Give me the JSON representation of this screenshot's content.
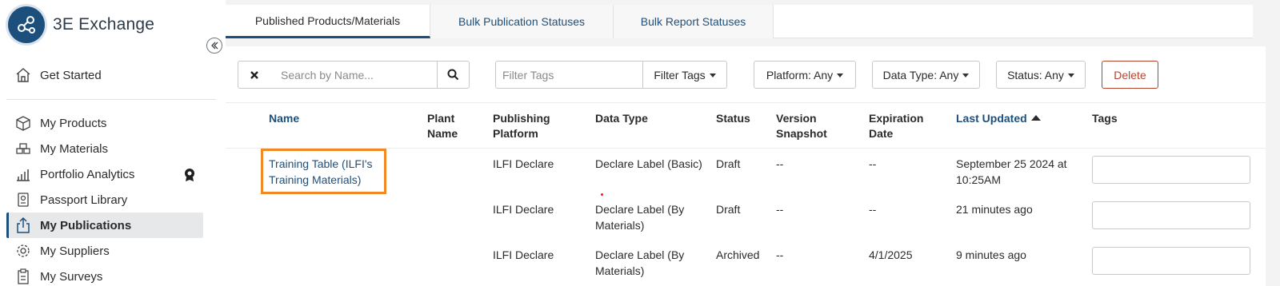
{
  "app": {
    "name": "3E Exchange"
  },
  "sidebar": {
    "items": [
      {
        "label": "Get Started",
        "icon": "home-icon"
      },
      {
        "label": "My Products",
        "icon": "box-icon"
      },
      {
        "label": "My Materials",
        "icon": "materials-icon"
      },
      {
        "label": "Portfolio Analytics",
        "icon": "bar-chart-icon"
      },
      {
        "label": "Passport Library",
        "icon": "passport-icon"
      },
      {
        "label": "My Publications",
        "icon": "upload-icon",
        "active": true
      },
      {
        "label": "My Suppliers",
        "icon": "suppliers-icon"
      },
      {
        "label": "My Surveys",
        "icon": "clipboard-icon"
      }
    ]
  },
  "tabs": [
    {
      "label": "Published Products/Materials",
      "active": true
    },
    {
      "label": "Bulk Publication Statuses"
    },
    {
      "label": "Bulk Report Statuses"
    }
  ],
  "toolbar": {
    "search_placeholder": "Search by Name...",
    "filter_tags_placeholder": "Filter Tags",
    "filter_tags_label": "Filter Tags",
    "platform_label": "Platform: Any",
    "data_type_label": "Data Type: Any",
    "status_label": "Status: Any",
    "delete_label": "Delete"
  },
  "table": {
    "columns": {
      "name": "Name",
      "plant_name": "Plant Name",
      "publishing_platform": "Publishing Platform",
      "data_type": "Data Type",
      "status": "Status",
      "version_snapshot": "Version Snapshot",
      "expiration_date": "Expiration Date",
      "last_updated": "Last Updated",
      "tags": "Tags"
    },
    "rows": [
      {
        "name": "Training Table (ILFI's Training Materials)",
        "plant_name": "",
        "platform": "ILFI Declare",
        "data_type": "Declare Label (Basic)",
        "status": "Draft",
        "version_snapshot": "--",
        "expiration_date": "--",
        "last_updated": "September 25 2024 at 10:25AM"
      },
      {
        "name": "",
        "plant_name": "",
        "platform": "ILFI Declare",
        "data_type": "Declare Label (By Materials)",
        "status": "Draft",
        "version_snapshot": "--",
        "expiration_date": "--",
        "last_updated": "21 minutes ago"
      },
      {
        "name": "",
        "plant_name": "",
        "platform": "ILFI Declare",
        "data_type": "Declare Label (By Materials)",
        "status": "Archived",
        "version_snapshot": "--",
        "expiration_date": "4/1/2025",
        "last_updated": "9 minutes ago"
      }
    ]
  },
  "colors": {
    "brand": "#1d4f7c",
    "highlight": "#f08a24",
    "delete": "#b3452e"
  }
}
